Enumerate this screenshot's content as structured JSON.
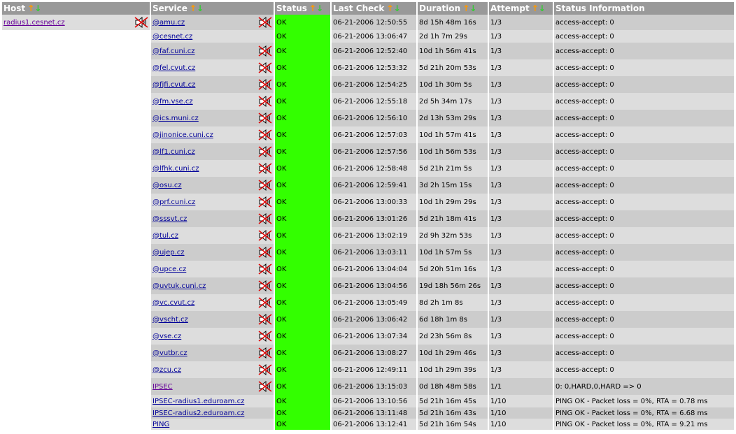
{
  "headers": [
    {
      "label": "Host",
      "sortable": true
    },
    {
      "label": "Service",
      "sortable": true
    },
    {
      "label": "Status",
      "sortable": true
    },
    {
      "label": "Last Check",
      "sortable": true
    },
    {
      "label": "Duration",
      "sortable": true
    },
    {
      "label": "Attempt",
      "sortable": true
    },
    {
      "label": "Status Information",
      "sortable": false
    }
  ],
  "sort_up_glyph": "↑",
  "sort_down_glyph": "↓",
  "host": "radius1.cesnet.cz",
  "colors": {
    "header_bg": "#999999",
    "ok": "#33ff00",
    "row_odd": "#cccccc",
    "row_even": "#dddddd",
    "link": "#000099"
  },
  "rows": [
    {
      "service": "@amu.cz",
      "notif_icon": true,
      "status": "OK",
      "last_check": "06-21-2006 12:50:55",
      "duration": "8d 15h 48m 16s",
      "attempt": "1/3",
      "info": "access-accept: 0"
    },
    {
      "service": "@cesnet.cz",
      "notif_icon": false,
      "status": "OK",
      "last_check": "06-21-2006 13:06:47",
      "duration": "2d 1h 7m 29s",
      "attempt": "1/3",
      "info": "access-accept: 0"
    },
    {
      "service": "@faf.cuni.cz",
      "notif_icon": true,
      "status": "OK",
      "last_check": "06-21-2006 12:52:40",
      "duration": "10d 1h 56m 41s",
      "attempt": "1/3",
      "info": "access-accept: 0"
    },
    {
      "service": "@fel.cvut.cz",
      "notif_icon": true,
      "status": "OK",
      "last_check": "06-21-2006 12:53:32",
      "duration": "5d 21h 20m 53s",
      "attempt": "1/3",
      "info": "access-accept: 0"
    },
    {
      "service": "@fjfi.cvut.cz",
      "notif_icon": true,
      "status": "OK",
      "last_check": "06-21-2006 12:54:25",
      "duration": "10d 1h 30m 5s",
      "attempt": "1/3",
      "info": "access-accept: 0"
    },
    {
      "service": "@fm.vse.cz",
      "notif_icon": true,
      "status": "OK",
      "last_check": "06-21-2006 12:55:18",
      "duration": "2d 5h 34m 17s",
      "attempt": "1/3",
      "info": "access-accept: 0"
    },
    {
      "service": "@ics.muni.cz",
      "notif_icon": true,
      "status": "OK",
      "last_check": "06-21-2006 12:56:10",
      "duration": "2d 13h 53m 29s",
      "attempt": "1/3",
      "info": "access-accept: 0"
    },
    {
      "service": "@jinonice.cuni.cz",
      "notif_icon": true,
      "status": "OK",
      "last_check": "06-21-2006 12:57:03",
      "duration": "10d 1h 57m 41s",
      "attempt": "1/3",
      "info": "access-accept: 0"
    },
    {
      "service": "@lf1.cuni.cz",
      "notif_icon": true,
      "status": "OK",
      "last_check": "06-21-2006 12:57:56",
      "duration": "10d 1h 56m 53s",
      "attempt": "1/3",
      "info": "access-accept: 0"
    },
    {
      "service": "@lfhk.cuni.cz",
      "notif_icon": true,
      "status": "OK",
      "last_check": "06-21-2006 12:58:48",
      "duration": "5d 21h 21m 5s",
      "attempt": "1/3",
      "info": "access-accept: 0"
    },
    {
      "service": "@osu.cz",
      "notif_icon": true,
      "status": "OK",
      "last_check": "06-21-2006 12:59:41",
      "duration": "3d 2h 15m 15s",
      "attempt": "1/3",
      "info": "access-accept: 0"
    },
    {
      "service": "@prf.cuni.cz",
      "notif_icon": true,
      "status": "OK",
      "last_check": "06-21-2006 13:00:33",
      "duration": "10d 1h 29m 29s",
      "attempt": "1/3",
      "info": "access-accept: 0"
    },
    {
      "service": "@sssvt.cz",
      "notif_icon": true,
      "status": "OK",
      "last_check": "06-21-2006 13:01:26",
      "duration": "5d 21h 18m 41s",
      "attempt": "1/3",
      "info": "access-accept: 0"
    },
    {
      "service": "@tul.cz",
      "notif_icon": true,
      "status": "OK",
      "last_check": "06-21-2006 13:02:19",
      "duration": "2d 9h 32m 53s",
      "attempt": "1/3",
      "info": "access-accept: 0"
    },
    {
      "service": "@ujep.cz",
      "notif_icon": true,
      "status": "OK",
      "last_check": "06-21-2006 13:03:11",
      "duration": "10d 1h 57m 5s",
      "attempt": "1/3",
      "info": "access-accept: 0"
    },
    {
      "service": "@upce.cz",
      "notif_icon": true,
      "status": "OK",
      "last_check": "06-21-2006 13:04:04",
      "duration": "5d 20h 51m 16s",
      "attempt": "1/3",
      "info": "access-accept: 0"
    },
    {
      "service": "@uvtuk.cuni.cz",
      "notif_icon": true,
      "status": "OK",
      "last_check": "06-21-2006 13:04:56",
      "duration": "19d 18h 56m 26s",
      "attempt": "1/3",
      "info": "access-accept: 0"
    },
    {
      "service": "@vc.cvut.cz",
      "notif_icon": true,
      "status": "OK",
      "last_check": "06-21-2006 13:05:49",
      "duration": "8d 2h 1m 8s",
      "attempt": "1/3",
      "info": "access-accept: 0"
    },
    {
      "service": "@vscht.cz",
      "notif_icon": true,
      "status": "OK",
      "last_check": "06-21-2006 13:06:42",
      "duration": "6d 18h 1m 8s",
      "attempt": "1/3",
      "info": "access-accept: 0"
    },
    {
      "service": "@vse.cz",
      "notif_icon": true,
      "status": "OK",
      "last_check": "06-21-2006 13:07:34",
      "duration": "2d 23h 56m 8s",
      "attempt": "1/3",
      "info": "access-accept: 0"
    },
    {
      "service": "@vutbr.cz",
      "notif_icon": true,
      "status": "OK",
      "last_check": "06-21-2006 13:08:27",
      "duration": "10d 1h 29m 46s",
      "attempt": "1/3",
      "info": "access-accept: 0"
    },
    {
      "service": "@zcu.cz",
      "notif_icon": true,
      "status": "OK",
      "last_check": "06-21-2006 12:49:11",
      "duration": "10d 1h 29m 39s",
      "attempt": "1/3",
      "info": "access-accept: 0"
    },
    {
      "service": "IPSEC",
      "notif_icon": true,
      "status": "OK",
      "last_check": "06-21-2006 13:15:03",
      "duration": "0d 18h 48m 58s",
      "attempt": "1/1",
      "info": "0: 0,HARD,0,HARD => 0"
    },
    {
      "service": "IPSEC-radius1.eduroam.cz",
      "notif_icon": false,
      "status": "OK",
      "last_check": "06-21-2006 13:10:56",
      "duration": "5d 21h 16m 45s",
      "attempt": "1/10",
      "info": "PING OK - Packet loss = 0%, RTA = 0.78 ms"
    },
    {
      "service": "IPSEC-radius2.eduroam.cz",
      "notif_icon": false,
      "status": "OK",
      "last_check": "06-21-2006 13:11:48",
      "duration": "5d 21h 16m 43s",
      "attempt": "1/10",
      "info": "PING OK - Packet loss = 0%, RTA = 6.68 ms"
    },
    {
      "service": "PING",
      "notif_icon": false,
      "status": "OK",
      "last_check": "06-21-2006 13:12:41",
      "duration": "5d 21h 16m 54s",
      "attempt": "1/10",
      "info": "PING OK - Packet loss = 0%, RTA = 9.21 ms"
    }
  ]
}
